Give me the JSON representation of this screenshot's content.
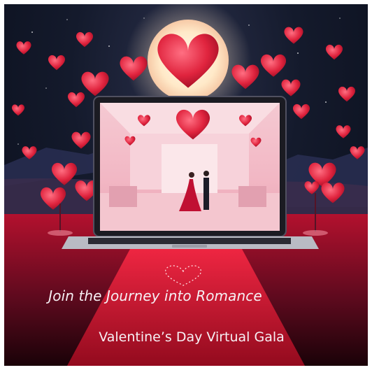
{
  "poster": {
    "tagline": "Join the Journey into Romance",
    "event_title": "Valentine’s Day Virtual Gala"
  },
  "colors": {
    "heart_red": "#e0243e",
    "carpet_red": "#c70f2a",
    "moon_glow": "#fff1d6",
    "night_sky": "#141a2c",
    "ballroom_pink": "#f3c6cf"
  },
  "icons": [
    "heart-icon",
    "laptop-icon",
    "moon-icon"
  ]
}
